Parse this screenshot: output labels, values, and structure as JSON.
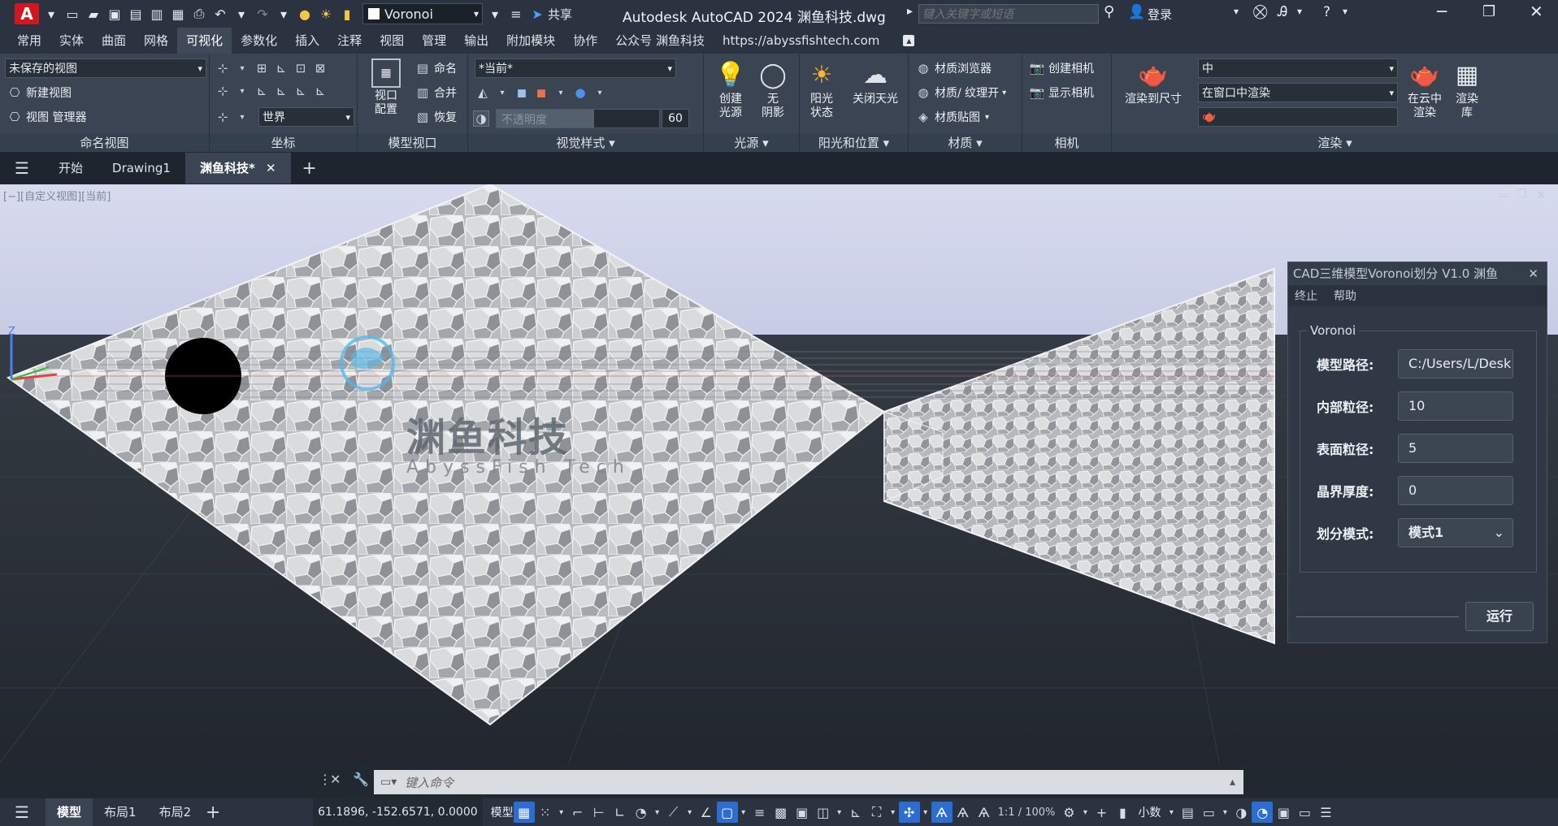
{
  "titlebar": {
    "app_logo": "A",
    "workspace": "Voronoi",
    "share_label": "共享",
    "title": "Autodesk AutoCAD 2024    渊鱼科技.dwg",
    "search_placeholder": "键入关键字或短语",
    "login_label": "登录"
  },
  "menu": {
    "tabs": [
      "常用",
      "实体",
      "曲面",
      "网格",
      "可视化",
      "参数化",
      "插入",
      "注释",
      "视图",
      "管理",
      "输出",
      "附加模块",
      "协作",
      "公众号 渊鱼科技",
      "https://abyssfishtech.com"
    ]
  },
  "ribbon": {
    "named_views": {
      "title": "命名视图",
      "current_view": "未保存的视图",
      "new_view": "新建视图",
      "view_manager": "视图 管理器"
    },
    "coordinates": {
      "title": "坐标",
      "ucs_select": "世界"
    },
    "model_viewports": {
      "title": "模型视口",
      "viewport_config": "视口\n配置",
      "name": "命名",
      "join": "合并",
      "restore": "恢复"
    },
    "visual_styles": {
      "title": "视觉样式",
      "current": "*当前*",
      "opacity_label": "不透明度",
      "opacity_value": "60"
    },
    "lights": {
      "title": "光源",
      "create_light": "创建\n光源",
      "no_shadow": "无\n阴影"
    },
    "sun": {
      "title": "阳光和位置",
      "sun_status": "阳光\n状态",
      "sky_off": "关闭天光"
    },
    "materials": {
      "title": "材质",
      "browser": "材质浏览器",
      "texture_on": "材质/ 纹理开",
      "mapping": "材质贴图"
    },
    "camera": {
      "title": "相机",
      "create_camera": "创建相机",
      "show_camera": "显示相机"
    },
    "render": {
      "title": "渲染",
      "render_to_size": "渲染到尺寸",
      "quality": "中",
      "render_in": "在窗口中渲染",
      "cloud_render": "在云中\n渲染",
      "render_gallery": "渲染\n库"
    }
  },
  "doctabs": {
    "items": [
      "开始",
      "Drawing1",
      "渊鱼科技*"
    ]
  },
  "viewport": {
    "view_label": "[−][自定义视图][当前]",
    "watermark_cn": "渊鱼科技",
    "watermark_en": "AbyssFish Tech"
  },
  "dialog": {
    "title": "CAD三维模型Voronoi划分 V1.0 渊鱼",
    "menu": [
      "终止",
      "帮助"
    ],
    "group_title": "Voronoi",
    "fields": [
      {
        "label": "模型路径:",
        "value": "C:/Users/L/Desk"
      },
      {
        "label": "内部粒径:",
        "value": "10"
      },
      {
        "label": "表面粒径:",
        "value": "5"
      },
      {
        "label": "晶界厚度:",
        "value": "0"
      },
      {
        "label": "划分模式:",
        "value": "模式1"
      }
    ],
    "run_label": "运行"
  },
  "cmdline": {
    "placeholder": "键入命令"
  },
  "statusbar": {
    "tabs": [
      "模型",
      "布局1",
      "布局2"
    ],
    "coords": "61.1896, -152.6571, 0.0000",
    "mode": "模型",
    "scale": "1:1 / 100%",
    "units": "小数"
  }
}
